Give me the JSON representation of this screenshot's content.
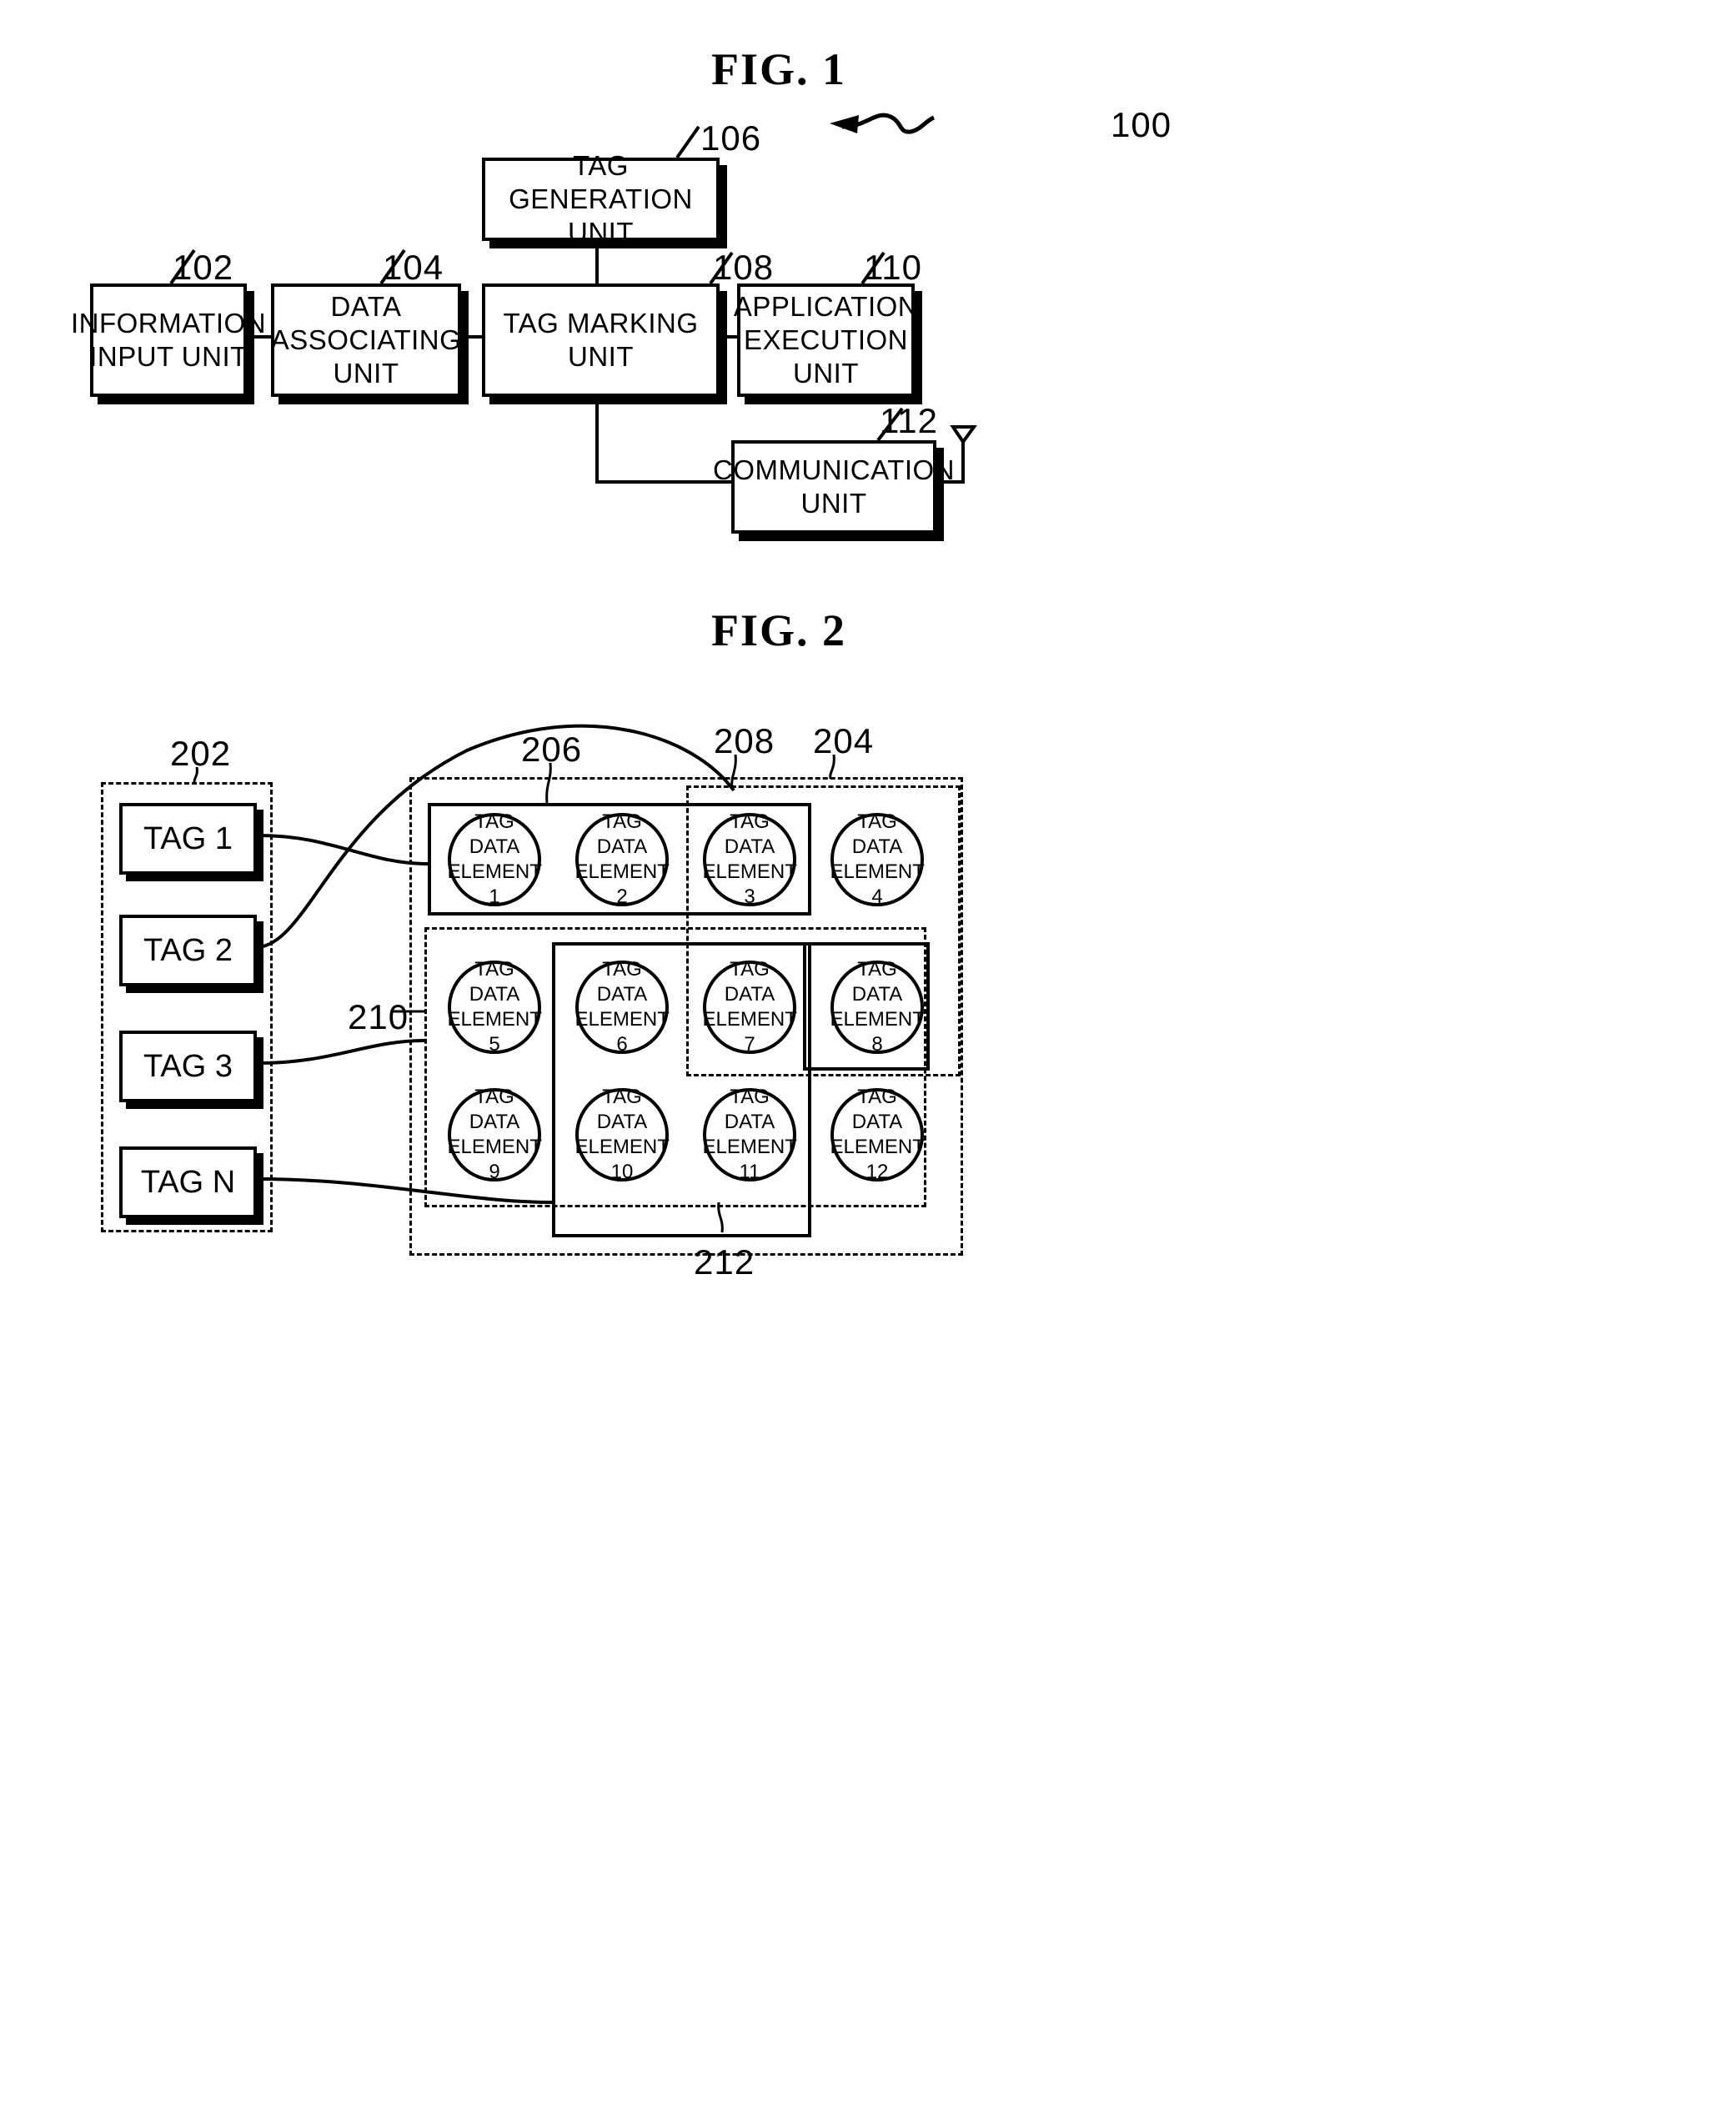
{
  "figures": [
    {
      "title": "FIG.  1"
    },
    {
      "title": "FIG.  2"
    }
  ],
  "fig1": {
    "title": "FIG.  1",
    "system_ref": "100",
    "blocks": [
      {
        "ref": "102",
        "label": "INFORMATION\nINPUT UNIT"
      },
      {
        "ref": "104",
        "label": "DATA\nASSOCIATING\nUNIT"
      },
      {
        "ref": "106",
        "label": "TAG GENERATION\nUNIT"
      },
      {
        "ref": "108",
        "label": "TAG MARKING\nUNIT"
      },
      {
        "ref": "110",
        "label": "APPLICATION\nEXECUTION\nUNIT"
      },
      {
        "ref": "112",
        "label": "COMMUNICATION\nUNIT"
      }
    ],
    "antenna": "antenna-symbol"
  },
  "fig2": {
    "title": "FIG.  2",
    "tag_group_ref": "202",
    "data_group_ref": "204",
    "subset_refs": [
      "206",
      "208",
      "210",
      "212"
    ],
    "tags": [
      {
        "label": "TAG 1"
      },
      {
        "label": "TAG 2"
      },
      {
        "label": "TAG 3"
      },
      {
        "label": "TAG N"
      }
    ],
    "elements": [
      {
        "line1": "TAG DATA",
        "line2": "ELEMENT 1"
      },
      {
        "line1": "TAG DATA",
        "line2": "ELEMENT 2"
      },
      {
        "line1": "TAG DATA",
        "line2": "ELEMENT 3"
      },
      {
        "line1": "TAG DATA",
        "line2": "ELEMENT 4"
      },
      {
        "line1": "TAG DATA",
        "line2": "ELEMENT 5"
      },
      {
        "line1": "TAG DATA",
        "line2": "ELEMENT 6"
      },
      {
        "line1": "TAG DATA",
        "line2": "ELEMENT 7"
      },
      {
        "line1": "TAG DATA",
        "line2": "ELEMENT 8"
      },
      {
        "line1": "TAG DATA",
        "line2": "ELEMENT 9"
      },
      {
        "line1": "TAG DATA",
        "line2": "ELEMENT 10"
      },
      {
        "line1": "TAG DATA",
        "line2": "ELEMENT 11"
      },
      {
        "line1": "TAG DATA",
        "line2": "ELEMENT 12"
      }
    ]
  },
  "colors": {
    "ink": "#000000",
    "paper": "#ffffff"
  }
}
